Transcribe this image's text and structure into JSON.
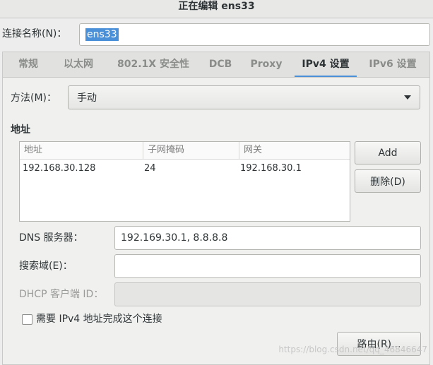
{
  "window": {
    "title": "正在编辑 ens33"
  },
  "connection_name": {
    "label": "连接名称(N)：",
    "value": "ens33"
  },
  "tabs": [
    {
      "label": "常规"
    },
    {
      "label": "以太网"
    },
    {
      "label": "802.1X 安全性"
    },
    {
      "label": "DCB"
    },
    {
      "label": "Proxy"
    },
    {
      "label": "IPv4 设置"
    },
    {
      "label": "IPv6 设置"
    }
  ],
  "ipv4": {
    "method_label": "方法(M)：",
    "method_value": "手动",
    "address_section": "地址",
    "table": {
      "columns": [
        "地址",
        "子网掩码",
        "网关"
      ],
      "rows": [
        [
          "192.168.30.128",
          "24",
          "192.168.30.1"
        ]
      ]
    },
    "add_button": "Add",
    "delete_button": "删除(D)",
    "dns_label": "DNS 服务器：",
    "dns_value": "192.169.30.1, 8.8.8.8",
    "search_label": "搜索域(E)：",
    "search_value": "",
    "dhcp_label": "DHCP 客户端 ID：",
    "dhcp_value": "",
    "require_checkbox_label": "需要 IPv4 地址完成这个连接",
    "routes_button": "路由(R)..."
  },
  "watermark": "https://blog.csdn.net/qq_46846647"
}
